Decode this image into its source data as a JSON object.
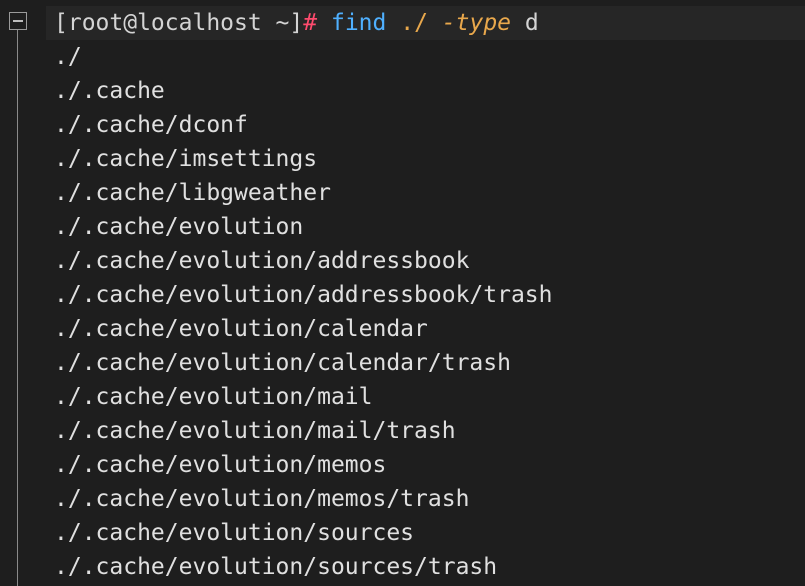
{
  "terminal": {
    "prompt": "[root@localhost ~]",
    "prompt_symbol": "#",
    "command": {
      "name": "find",
      "path": "./",
      "flag": "-type",
      "value": "d"
    },
    "output": [
      "./",
      "./.cache",
      "./.cache/dconf",
      "./.cache/imsettings",
      "./.cache/libgweather",
      "./.cache/evolution",
      "./.cache/evolution/addressbook",
      "./.cache/evolution/addressbook/trash",
      "./.cache/evolution/calendar",
      "./.cache/evolution/calendar/trash",
      "./.cache/evolution/mail",
      "./.cache/evolution/mail/trash",
      "./.cache/evolution/memos",
      "./.cache/evolution/memos/trash",
      "./.cache/evolution/sources",
      "./.cache/evolution/sources/trash"
    ],
    "colors": {
      "background": "#1e1e1e",
      "text": "#d4d4d4",
      "prompt_symbol": "#ff4b6e",
      "command": "#4fb0ff",
      "argument": "#e9a84c"
    },
    "icons": {
      "fold": "collapse-minus-icon"
    }
  }
}
